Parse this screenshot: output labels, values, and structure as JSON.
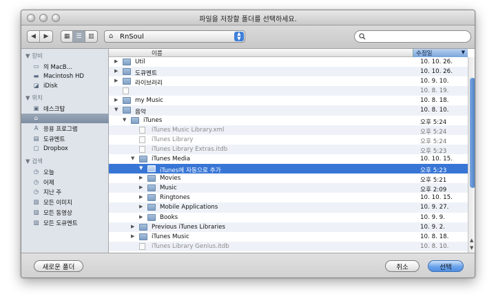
{
  "window": {
    "title": "파일을 저장할 폴더를 선택하세요."
  },
  "toolbar": {
    "path": "RnSoul",
    "search_placeholder": ""
  },
  "sidebar": {
    "sections": [
      {
        "header": "▼ 장비",
        "items": [
          {
            "label": "의 MacB...",
            "icon": "laptop-icon"
          },
          {
            "label": "Macintosh HD",
            "icon": "hard-drive-icon"
          },
          {
            "label": "iDisk",
            "icon": "idisk-icon"
          }
        ]
      },
      {
        "header": "▼ 위치",
        "items": [
          {
            "label": "데스크탑",
            "icon": "desktop-icon"
          },
          {
            "label": "",
            "icon": "home-icon",
            "selected": true
          },
          {
            "label": "응용 프로그램",
            "icon": "applications-icon"
          },
          {
            "label": "도큐멘트",
            "icon": "documents-icon"
          },
          {
            "label": "Dropbox",
            "icon": "dropbox-icon"
          }
        ]
      },
      {
        "header": "▼ 검색",
        "items": [
          {
            "label": "오늘",
            "icon": "clock-icon"
          },
          {
            "label": "어제",
            "icon": "clock-icon"
          },
          {
            "label": "지난 주",
            "icon": "clock-icon"
          },
          {
            "label": "모든 이미지",
            "icon": "smart-folder-icon"
          },
          {
            "label": "모든 동영상",
            "icon": "smart-folder-icon"
          },
          {
            "label": "모든 도큐멘트",
            "icon": "smart-folder-icon"
          }
        ]
      }
    ]
  },
  "columns": {
    "name": "이름",
    "date": "수정일"
  },
  "rows": [
    {
      "indent": 0,
      "tri": "▶",
      "kind": "folder",
      "name": "Util",
      "date": "10. 10. 26."
    },
    {
      "indent": 0,
      "tri": "▶",
      "kind": "folder",
      "name": "도큐멘트",
      "date": "10. 10. 26."
    },
    {
      "indent": 0,
      "tri": "▶",
      "kind": "folder",
      "name": "라이브러리",
      "date": "10. 9. 10."
    },
    {
      "indent": 0,
      "tri": "",
      "kind": "file",
      "name": "",
      "date": "10. 8. 19."
    },
    {
      "indent": 0,
      "tri": "▶",
      "kind": "folder",
      "name": "my Music",
      "date": "10. 8. 18."
    },
    {
      "indent": 0,
      "tri": "▼",
      "kind": "folder",
      "name": "음악",
      "date": "10. 8. 10."
    },
    {
      "indent": 1,
      "tri": "▼",
      "kind": "folder",
      "name": "iTunes",
      "date": "오후 5:24"
    },
    {
      "indent": 2,
      "tri": "",
      "kind": "file",
      "name": "iTunes Music Library.xml",
      "date": "오후 5:24"
    },
    {
      "indent": 2,
      "tri": "",
      "kind": "file",
      "name": "iTunes Library",
      "date": "오후 5:24"
    },
    {
      "indent": 2,
      "tri": "",
      "kind": "file",
      "name": "iTunes Library Extras.itdb",
      "date": "오후 5:23"
    },
    {
      "indent": 2,
      "tri": "▼",
      "kind": "folder",
      "name": "iTunes Media",
      "date": "10. 10. 15."
    },
    {
      "indent": 3,
      "tri": "▼",
      "kind": "folder",
      "name": "iTunes에 자동으로 추가",
      "date": "오후 5:23",
      "selected": true
    },
    {
      "indent": 3,
      "tri": "▶",
      "kind": "folder",
      "name": "Movies",
      "date": "오후 5:21"
    },
    {
      "indent": 3,
      "tri": "▶",
      "kind": "folder",
      "name": "Music",
      "date": "오후 2:09"
    },
    {
      "indent": 3,
      "tri": "▶",
      "kind": "folder",
      "name": "Ringtones",
      "date": "10. 10. 15."
    },
    {
      "indent": 3,
      "tri": "▶",
      "kind": "folder",
      "name": "Mobile Applications",
      "date": "10. 9. 27."
    },
    {
      "indent": 3,
      "tri": "▶",
      "kind": "folder",
      "name": "Books",
      "date": "10. 9. 9."
    },
    {
      "indent": 2,
      "tri": "▶",
      "kind": "folder",
      "name": "Previous iTunes Libraries",
      "date": "10. 9. 2."
    },
    {
      "indent": 2,
      "tri": "▶",
      "kind": "folder",
      "name": "iTunes Music",
      "date": "10. 8. 18."
    },
    {
      "indent": 2,
      "tri": "",
      "kind": "file",
      "name": "iTunes Library Genius.itdb",
      "date": "10. 8. 10."
    }
  ],
  "buttons": {
    "new_folder": "새로운 폴더",
    "cancel": "취소",
    "choose": "선택"
  }
}
